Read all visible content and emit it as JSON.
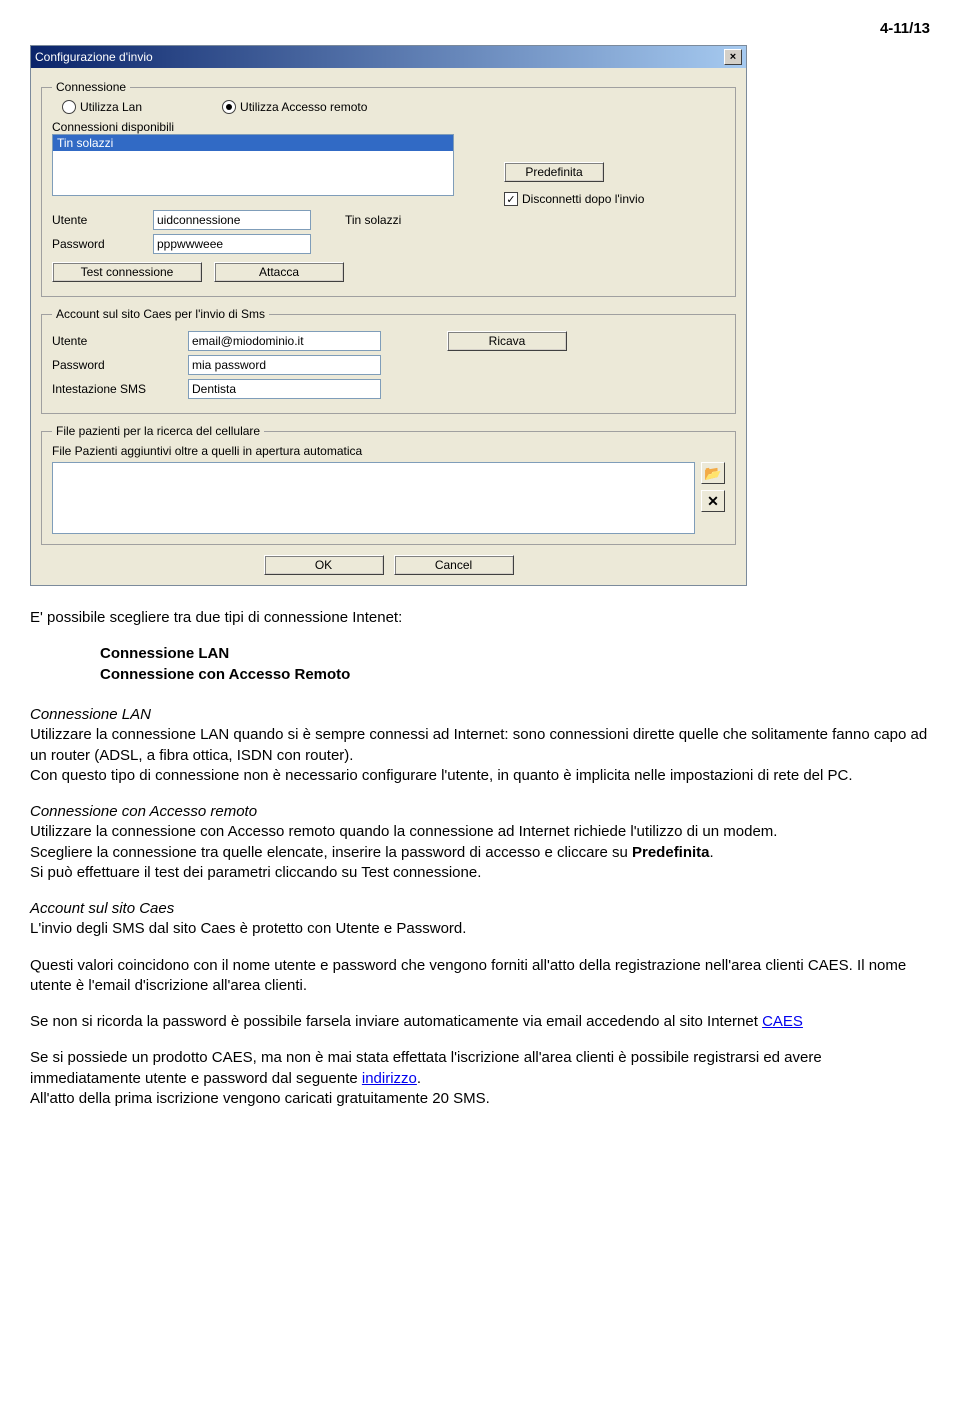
{
  "page_header": "4-11/13",
  "dialog": {
    "title": "Configurazione d'invio",
    "group_connessione": {
      "legend": "Connessione",
      "radio_lan": "Utilizza Lan",
      "radio_remote": "Utilizza Accesso remoto",
      "connessioni_label": "Connessioni disponibili",
      "listbox_item": "Tin solazzi",
      "predefinita": "Predefinita",
      "disconnetti": "Disconnetti dopo l'invio",
      "utente_label": "Utente",
      "utente_value": "uidconnessione",
      "conn_name_static": "Tin solazzi",
      "password_label": "Password",
      "password_value": "pppwwweee",
      "test_btn": "Test connessione",
      "attacca_btn": "Attacca"
    },
    "group_account": {
      "legend": "Account sul sito Caes per l'invio di Sms",
      "utente_label": "Utente",
      "utente_value": "email@miodominio.it",
      "ricava_btn": "Ricava",
      "password_label": "Password",
      "password_value": "mia password",
      "intest_label": "Intestazione SMS",
      "intest_value": "Dentista"
    },
    "group_file": {
      "legend": "File pazienti per la ricerca del cellulare",
      "sublabel": "File Pazienti aggiuntivi oltre a quelli in apertura automatica"
    },
    "ok": "OK",
    "cancel": "Cancel"
  },
  "doc": {
    "p1": "E' possibile scegliere tra due tipi di connessione Intenet:",
    "b1": "Connessione LAN",
    "b2": "Connessione con Accesso Remoto",
    "h_lan": "Connessione LAN",
    "p_lan": "Utilizzare la connessione LAN quando si è sempre connessi ad Internet: sono connessioni dirette quelle che solitamente fanno capo ad un router (ADSL, a fibra ottica, ISDN con router).\nCon questo tipo di connessione non è necessario configurare l'utente, in quanto è implicita nelle impostazioni di rete del PC.",
    "h_rem": "Connessione con Accesso remoto",
    "p_rem1": "Utilizzare la connessione con Accesso remoto quando la connessione ad Internet richiede l'utilizzo di un modem.",
    "p_rem2a": "Scegliere la connessione tra quelle elencate, inserire la password di accesso e cliccare su ",
    "p_rem2b": "Predefinita",
    "p_rem2c": ".",
    "p_rem3": "Si può effettuare il test dei parametri cliccando su Test connessione.",
    "h_acc": "Account sul sito Caes",
    "p_acc1": "L'invio degli SMS dal sito Caes è protetto con Utente e Password.",
    "p_acc2": "Questi valori coincidono con il nome utente e password che vengono forniti all'atto della registrazione nell'area clienti CAES. Il nome utente è l'email d'iscrizione all'area clienti.",
    "p_acc3a": "Se non si ricorda la password è possibile farsela inviare automaticamente via email accedendo al sito Internet ",
    "link_caes": "CAES",
    "p_acc4a": "Se si possiede un prodotto CAES, ma non è mai stata effettata l'iscrizione all'area clienti è possibile registrarsi ed avere immediatamente utente e password dal seguente ",
    "link_indirizzo": "indirizzo",
    "p_acc4b": ".",
    "p_acc5": "All'atto della prima iscrizione vengono caricati gratuitamente 20 SMS."
  }
}
